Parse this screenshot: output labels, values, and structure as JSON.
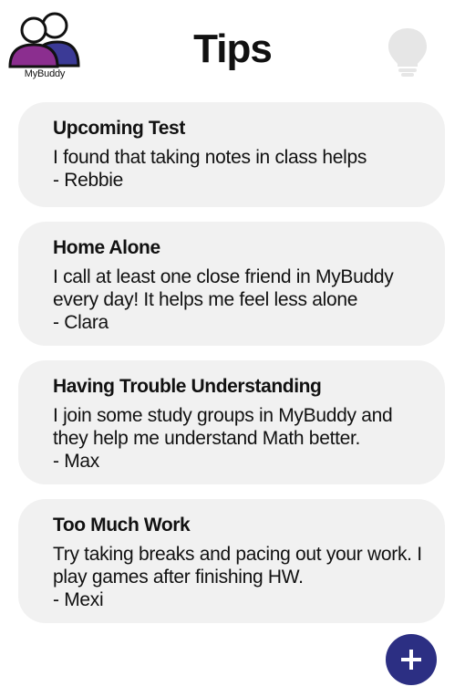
{
  "app": {
    "logo_text": "MyBuddy",
    "title": "Tips",
    "logo_icon": "two-people-icon",
    "header_icon": "lightbulb-icon",
    "add_icon": "plus-icon"
  },
  "colors": {
    "accent": "#2c2f83",
    "logo_person_left": "#8b2e8f",
    "logo_person_right": "#3b3a96",
    "card_background": "#f1f1f1",
    "bulb": "#e6e6e6"
  },
  "tips": [
    {
      "title": "Upcoming Test",
      "body": "I found that taking notes in class helps",
      "author": "- Rebbie"
    },
    {
      "title": "Home Alone",
      "body": "I call at least one close friend in MyBuddy every day! It helps me feel less alone",
      "author": "- Clara"
    },
    {
      "title": "Having Trouble Understanding",
      "body": "I join some study groups in MyBuddy and they help me understand Math better.",
      "author": "- Max"
    },
    {
      "title": "Too Much Work",
      "body": "Try taking breaks and pacing out your work. I play games after finishing HW.",
      "author": "- Mexi"
    }
  ]
}
